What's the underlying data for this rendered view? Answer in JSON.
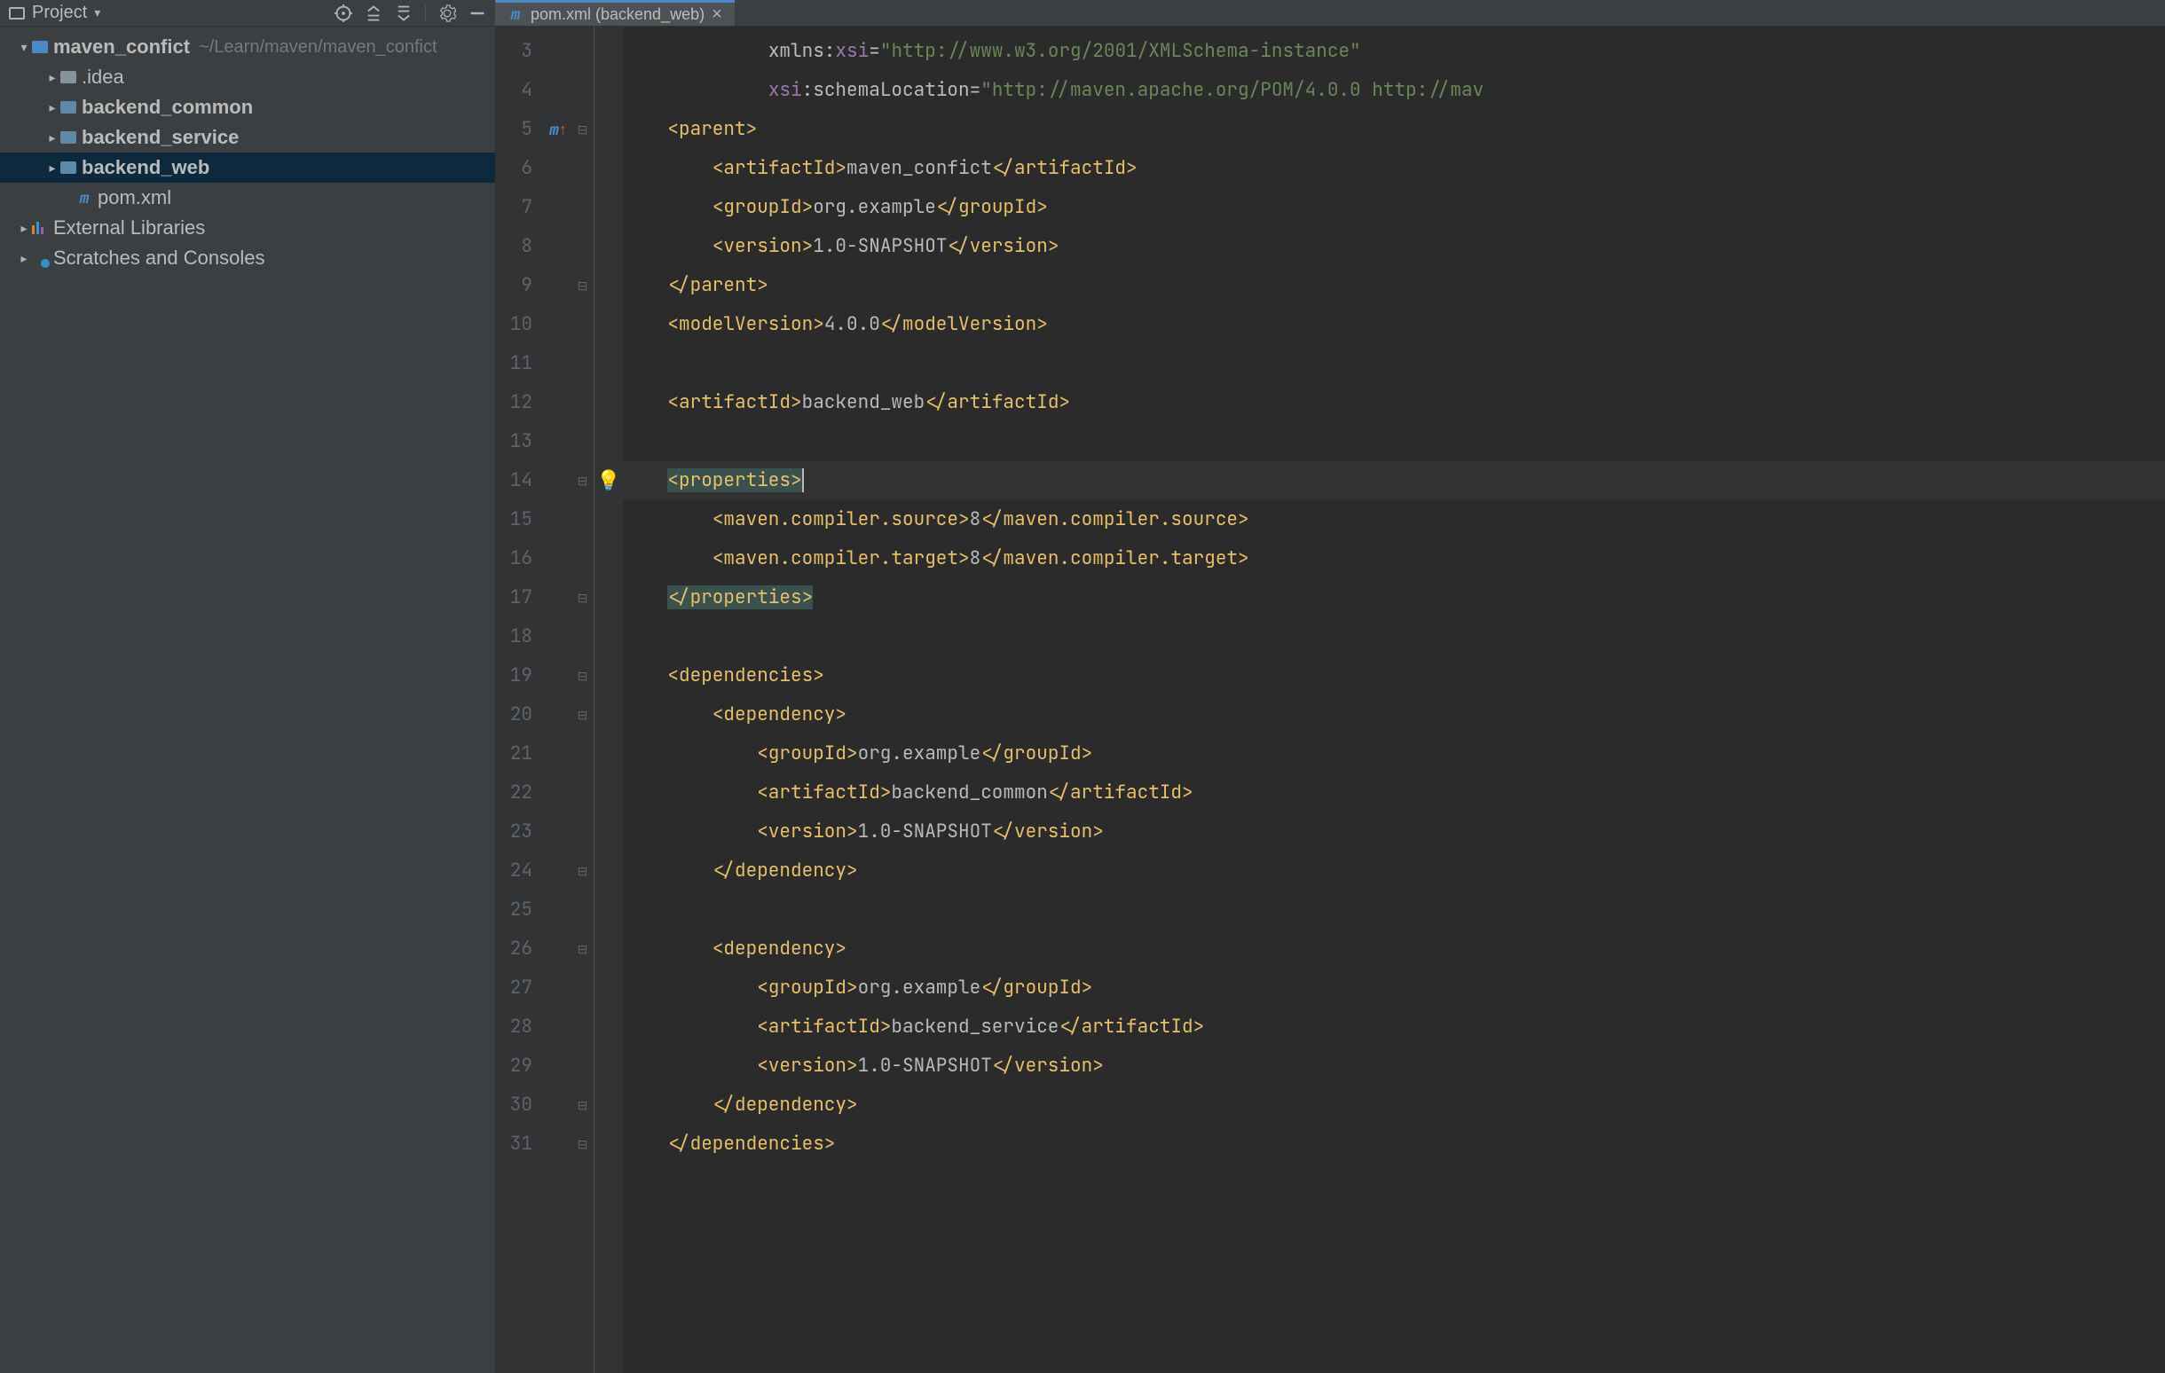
{
  "sidebar": {
    "title": "Project",
    "nodes": [
      {
        "indent": 18,
        "expand": "▾",
        "icon": "module",
        "label": "maven_confict",
        "bold": true,
        "path": "~/Learn/maven/maven_confict"
      },
      {
        "indent": 50,
        "expand": "▸",
        "icon": "folder",
        "label": ".idea"
      },
      {
        "indent": 50,
        "expand": "▸",
        "icon": "source",
        "label": "backend_common",
        "bold": true
      },
      {
        "indent": 50,
        "expand": "▸",
        "icon": "source",
        "label": "backend_service",
        "bold": true
      },
      {
        "indent": 50,
        "expand": "▸",
        "icon": "source",
        "label": "backend_web",
        "bold": true,
        "selected": true
      },
      {
        "indent": 68,
        "expand": "",
        "icon": "m",
        "label": "pom.xml"
      },
      {
        "indent": 18,
        "expand": "▸",
        "icon": "lib",
        "label": "External Libraries"
      },
      {
        "indent": 18,
        "expand": "▸",
        "icon": "scratch",
        "label": "Scratches and Consoles"
      }
    ]
  },
  "tab": {
    "label": "pom.xml (backend_web)"
  },
  "lineStart": 3,
  "code": {
    "l3": {
      "indent": "             ",
      "ns": "xmlns:",
      "attr": "xsi",
      "eq": "=",
      "val": "\"http://www.w3.org/2001/XMLSchema-instance\""
    },
    "l4": {
      "indent": "             ",
      "attr": "xsi",
      "ns": ":schemaLocation",
      "eq": "=",
      "val": "\"http://maven.apache.org/POM/4.0.0 http://mav"
    },
    "l5": "    <parent>",
    "l6": {
      "indent": "        ",
      "open": "<artifactId>",
      "text": "maven_confict",
      "close": "</artifactId>"
    },
    "l7": {
      "indent": "        ",
      "open": "<groupId>",
      "text": "org.example",
      "close": "</groupId>"
    },
    "l8": {
      "indent": "        ",
      "open": "<version>",
      "text": "1.0-SNAPSHOT",
      "close": "</version>"
    },
    "l9": "    </parent>",
    "l10": {
      "indent": "    ",
      "open": "<modelVersion>",
      "text": "4.0.0",
      "close": "</modelVersion>"
    },
    "l12": {
      "indent": "    ",
      "open": "<artifactId>",
      "text": "backend_web",
      "close": "</artifactId>"
    },
    "l14": "    <properties>",
    "l15": {
      "indent": "        ",
      "open": "<maven.compiler.source>",
      "text": "8",
      "close": "</maven.compiler.source>"
    },
    "l16": {
      "indent": "        ",
      "open": "<maven.compiler.target>",
      "text": "8",
      "close": "</maven.compiler.target>"
    },
    "l17": "    </properties>",
    "l19": "    <dependencies>",
    "l20": "        <dependency>",
    "l21": {
      "indent": "            ",
      "open": "<groupId>",
      "text": "org.example",
      "close": "</groupId>"
    },
    "l22": {
      "indent": "            ",
      "open": "<artifactId>",
      "text": "backend_common",
      "close": "</artifactId>"
    },
    "l23": {
      "indent": "            ",
      "open": "<version>",
      "text": "1.0-SNAPSHOT",
      "close": "</version>"
    },
    "l24": "        </dependency>",
    "l26": "        <dependency>",
    "l27": {
      "indent": "            ",
      "open": "<groupId>",
      "text": "org.example",
      "close": "</groupId>"
    },
    "l28": {
      "indent": "            ",
      "open": "<artifactId>",
      "text": "backend_service",
      "close": "</artifactId>"
    },
    "l29": {
      "indent": "            ",
      "open": "<version>",
      "text": "1.0-SNAPSHOT",
      "close": "</version>"
    },
    "l30": "        </dependency>",
    "l31": "    </dependencies>"
  },
  "gutter": {
    "lines": [
      "3",
      "4",
      "5",
      "6",
      "7",
      "8",
      "9",
      "10",
      "11",
      "12",
      "13",
      "14",
      "15",
      "16",
      "17",
      "18",
      "19",
      "20",
      "21",
      "22",
      "23",
      "24",
      "25",
      "26",
      "27",
      "28",
      "29",
      "30",
      "31"
    ],
    "marks": {
      "5": "m↑"
    },
    "folds": {
      "5": "⊟",
      "9": "⊟",
      "14": "⊟",
      "17": "⊟",
      "19": "⊟",
      "20": "⊟",
      "24": "⊟",
      "26": "⊟",
      "30": "⊟",
      "31": "⊟"
    },
    "bulb": {
      "14": true
    }
  }
}
